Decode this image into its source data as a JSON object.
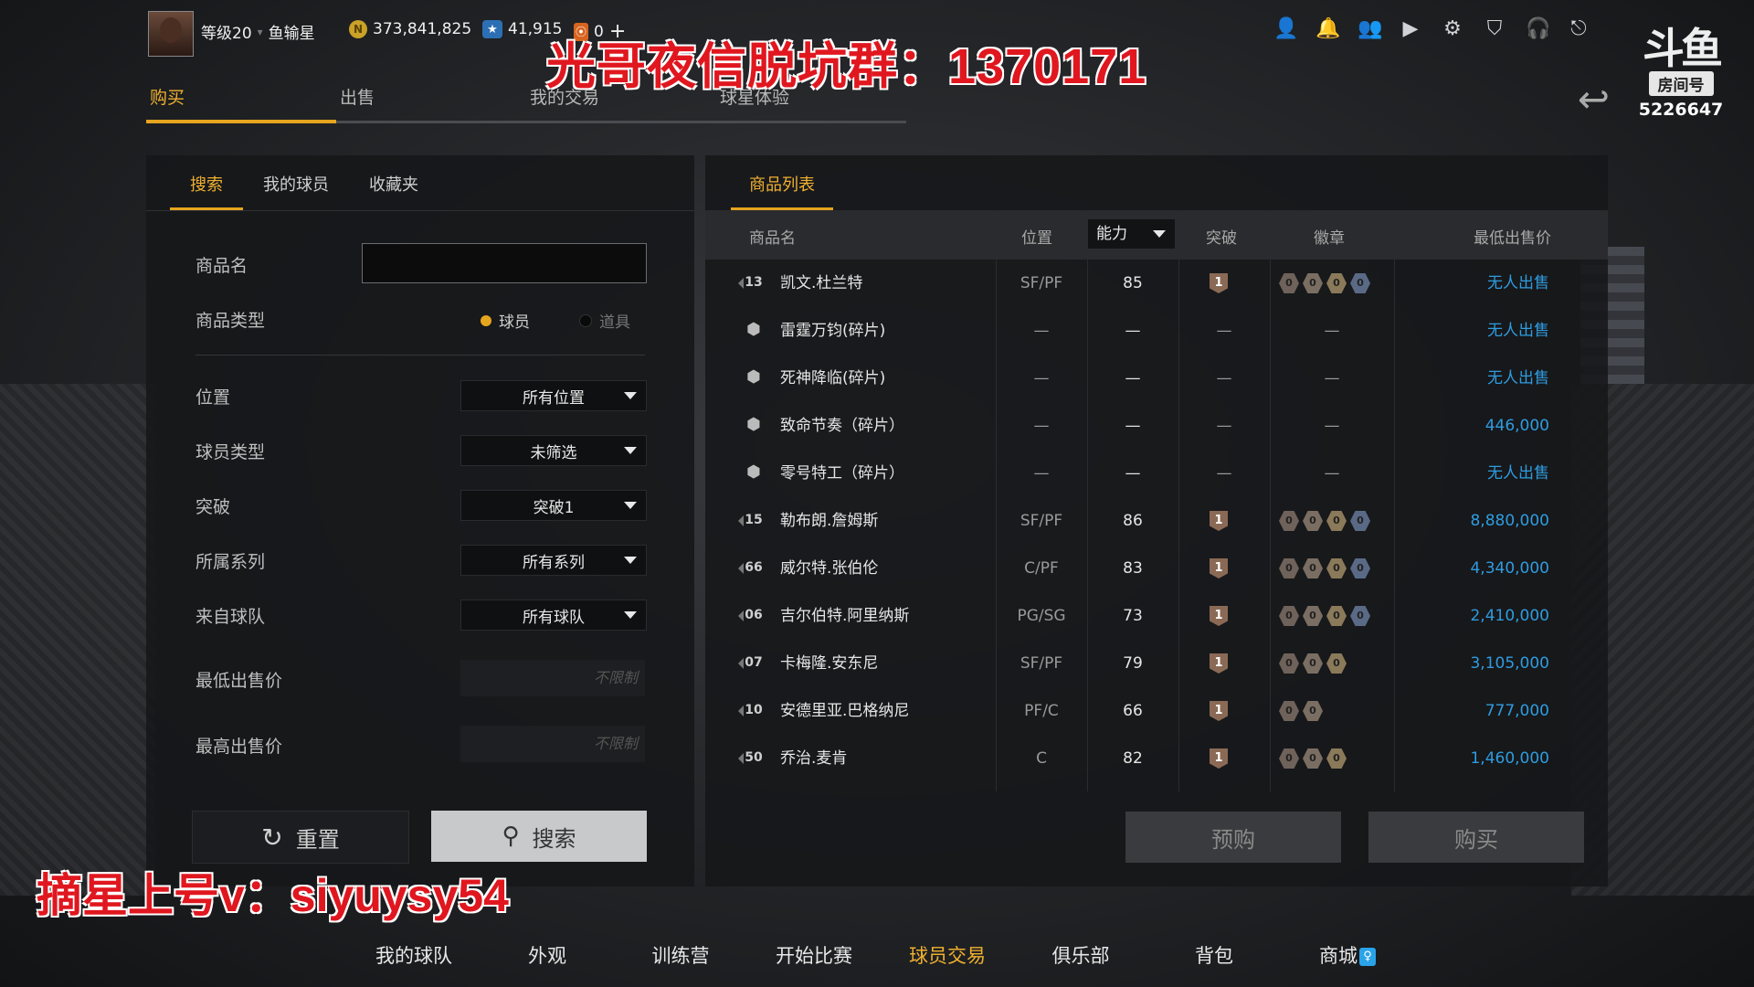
{
  "profile": {
    "level": "等级20",
    "name": "鱼输星",
    "coins": "373,841,825",
    "stars": "41,915",
    "tickets": "0",
    "plus": "+"
  },
  "watermark_top": "光哥夜信脱坑群：1370171",
  "watermark_bottom": "摘星上号v：siyuysy54",
  "room": {
    "label": "房间号",
    "number": "5226647",
    "logo": "斗鱼"
  },
  "main_tabs": [
    "购买",
    "出售",
    "我的交易",
    "球星体验"
  ],
  "left": {
    "tabs": [
      "搜索",
      "我的球员",
      "收藏夹"
    ],
    "name_label": "商品名",
    "type_label": "商品类型",
    "type_options": [
      "球员",
      "道具"
    ],
    "filters": [
      {
        "label": "位置",
        "value": "所有位置"
      },
      {
        "label": "球员类型",
        "value": "未筛选"
      },
      {
        "label": "突破",
        "value": "突破1"
      },
      {
        "label": "所属系列",
        "value": "所有系列"
      },
      {
        "label": "来自球队",
        "value": "所有球队"
      }
    ],
    "min_price_label": "最低出售价",
    "max_price_label": "最高出售价",
    "price_placeholder": "不限制",
    "reset": "重置",
    "search": "搜索"
  },
  "right": {
    "tab": "商品列表",
    "headers": {
      "name": "商品名",
      "position": "位置",
      "ability": "能力",
      "breakthrough": "突破",
      "badge": "徽章",
      "min_price": "最低出售价"
    },
    "rows": [
      {
        "num": "13",
        "name": "凯文.杜兰特",
        "pos": "SF/PF",
        "ability": "85",
        "break": "1",
        "badges": [
          "0",
          "0",
          "0",
          "0"
        ],
        "price": "无人出售"
      },
      {
        "num": "",
        "name": "雷霆万钧(碎片)",
        "pos": "—",
        "ability": "—",
        "break": "—",
        "badges": [],
        "price": "无人出售"
      },
      {
        "num": "",
        "name": "死神降临(碎片)",
        "pos": "—",
        "ability": "—",
        "break": "—",
        "badges": [],
        "price": "无人出售"
      },
      {
        "num": "",
        "name": "致命节奏（碎片）",
        "pos": "—",
        "ability": "—",
        "break": "—",
        "badges": [],
        "price": "446,000"
      },
      {
        "num": "",
        "name": "零号特工（碎片）",
        "pos": "—",
        "ability": "—",
        "break": "—",
        "badges": [],
        "price": "无人出售"
      },
      {
        "num": "15",
        "name": "勒布朗.詹姆斯",
        "pos": "SF/PF",
        "ability": "86",
        "break": "1",
        "badges": [
          "0",
          "0",
          "0",
          "0"
        ],
        "price": "8,880,000"
      },
      {
        "num": "66",
        "name": "威尔特.张伯伦",
        "pos": "C/PF",
        "ability": "83",
        "break": "1",
        "badges": [
          "0",
          "0",
          "0",
          "0"
        ],
        "price": "4,340,000"
      },
      {
        "num": "06",
        "name": "吉尔伯特.阿里纳斯",
        "pos": "PG/SG",
        "ability": "73",
        "break": "1",
        "badges": [
          "0",
          "0",
          "0",
          "0"
        ],
        "price": "2,410,000"
      },
      {
        "num": "07",
        "name": "卡梅隆.安东尼",
        "pos": "SF/PF",
        "ability": "79",
        "break": "1",
        "badges": [
          "0",
          "0",
          "0"
        ],
        "price": "3,105,000"
      },
      {
        "num": "10",
        "name": "安德里亚.巴格纳尼",
        "pos": "PF/C",
        "ability": "66",
        "break": "1",
        "badges": [
          "0",
          "0"
        ],
        "price": "777,000"
      },
      {
        "num": "50",
        "name": "乔治.麦肯",
        "pos": "C",
        "ability": "82",
        "break": "1",
        "badges": [
          "0",
          "0",
          "0"
        ],
        "price": "1,460,000"
      }
    ],
    "preorder": "预购",
    "buy": "购买"
  },
  "bottom_nav": [
    "我的球队",
    "外观",
    "训练营",
    "开始比赛",
    "球员交易",
    "俱乐部",
    "背包",
    "商城"
  ],
  "colors": {
    "accent": "#e6a51f",
    "price": "#2f9ce0",
    "watermark": "#e0171f"
  }
}
